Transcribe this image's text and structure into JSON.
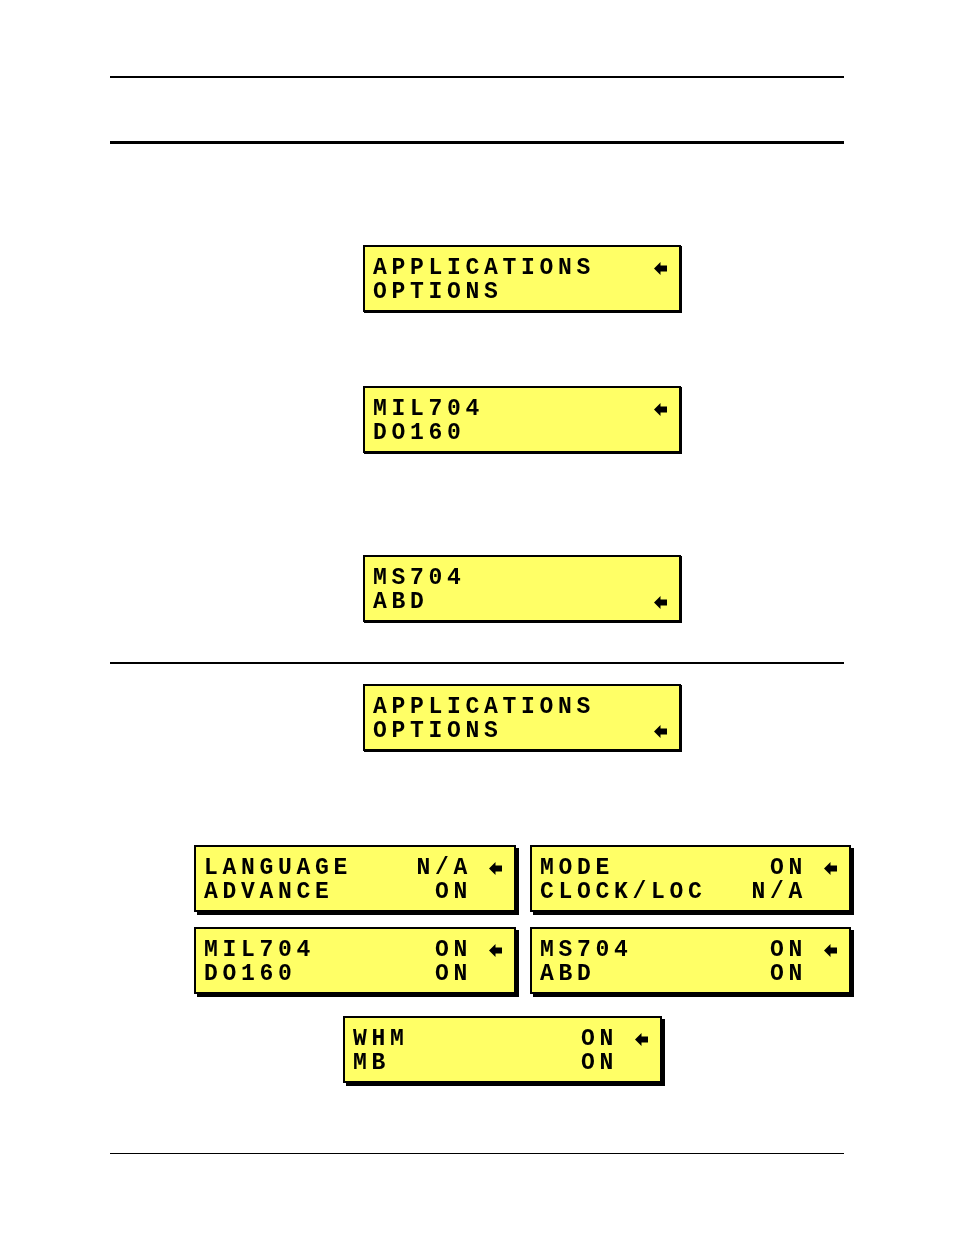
{
  "upper_displays": [
    {
      "lines": [
        {
          "label": "APPLICATIONS",
          "selected": true
        },
        {
          "label": "OPTIONS",
          "selected": false
        }
      ]
    },
    {
      "lines": [
        {
          "label": "MIL704",
          "selected": true
        },
        {
          "label": "DO160",
          "selected": false
        }
      ]
    },
    {
      "lines": [
        {
          "label": "MS704",
          "selected": false
        },
        {
          "label": "ABD",
          "selected": true
        }
      ]
    }
  ],
  "lower_displays": [
    {
      "lines": [
        {
          "label": "APPLICATIONS",
          "selected": false
        },
        {
          "label": "OPTIONS",
          "selected": true
        }
      ]
    }
  ],
  "settings_displays": [
    {
      "lines": [
        {
          "label": "LANGUAGE",
          "value": "N/A",
          "selected": true
        },
        {
          "label": "ADVANCE",
          "value": "ON",
          "selected": false
        }
      ]
    },
    {
      "lines": [
        {
          "label": "MODE",
          "value": "ON",
          "selected": true
        },
        {
          "label": "CLOCK/LOC",
          "value": "N/A",
          "selected": false
        }
      ]
    },
    {
      "lines": [
        {
          "label": "MIL704",
          "value": "ON",
          "selected": true
        },
        {
          "label": "DO160",
          "value": "ON",
          "selected": false
        }
      ]
    },
    {
      "lines": [
        {
          "label": "MS704",
          "value": "ON",
          "selected": true
        },
        {
          "label": "ABD",
          "value": "ON",
          "selected": false
        }
      ]
    },
    {
      "lines": [
        {
          "label": "WHM",
          "value": "ON",
          "selected": true
        },
        {
          "label": "MB",
          "value": "ON",
          "selected": false
        }
      ]
    }
  ]
}
